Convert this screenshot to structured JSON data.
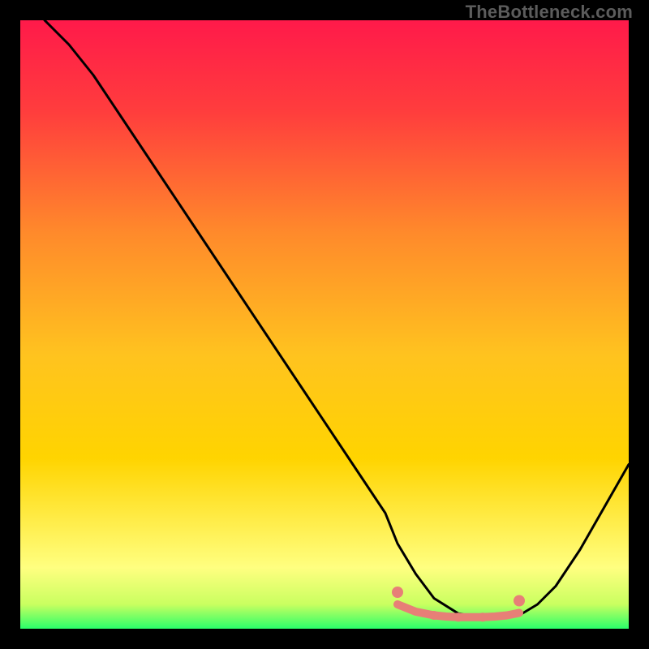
{
  "watermark": "TheBottleneck.com",
  "chart_data": {
    "type": "line",
    "title": "",
    "xlabel": "",
    "ylabel": "",
    "xlim": [
      0,
      100
    ],
    "ylim": [
      0,
      100
    ],
    "grid": false,
    "legend": false,
    "background": {
      "top_color": "#ff1a4a",
      "mid_color": "#ffd400",
      "band_color": "#ffff80",
      "bottom_color": "#2aff6a"
    },
    "series": [
      {
        "name": "bottleneck-curve",
        "stroke": "#000000",
        "x": [
          4,
          8,
          12,
          16,
          20,
          24,
          28,
          32,
          36,
          40,
          44,
          48,
          52,
          56,
          60,
          62,
          65,
          68,
          72,
          76,
          79,
          82,
          85,
          88,
          92,
          96,
          100
        ],
        "y": [
          100,
          96,
          91,
          85,
          79,
          73,
          67,
          61,
          55,
          49,
          43,
          37,
          31,
          25,
          19,
          14,
          9,
          5,
          2.5,
          1.8,
          1.8,
          2.2,
          4,
          7,
          13,
          20,
          27
        ]
      }
    ],
    "flat_region": {
      "x_start": 62,
      "x_end": 82,
      "color": "#e77f77",
      "points_x": [
        62,
        65,
        68,
        70,
        72,
        74,
        76,
        78,
        80,
        82
      ],
      "points_y": [
        4.0,
        2.8,
        2.2,
        2.0,
        1.9,
        1.9,
        1.9,
        2.0,
        2.2,
        2.6
      ]
    }
  }
}
